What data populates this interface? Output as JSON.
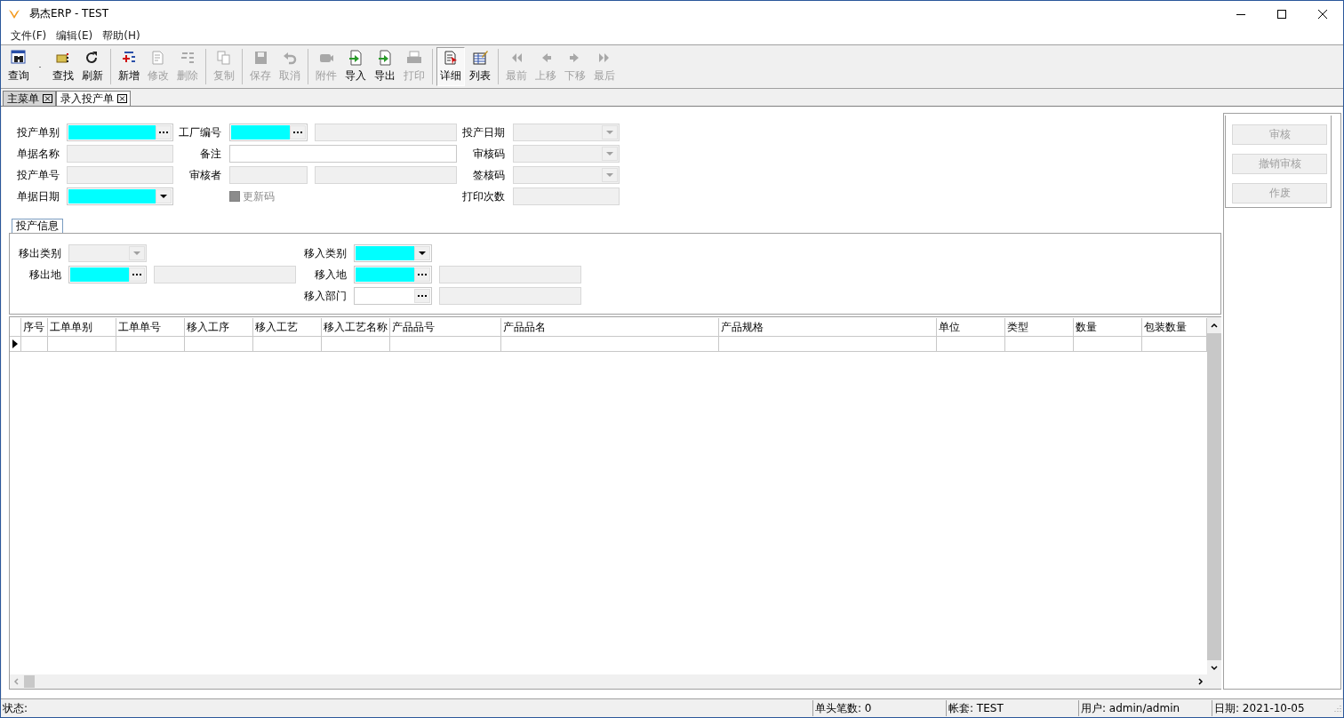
{
  "window": {
    "title": "易杰ERP - TEST"
  },
  "menu": [
    "文件(F)",
    "编辑(E)",
    "帮助(H)"
  ],
  "toolbar": {
    "groups": [
      [
        {
          "label": "查询",
          "disabled": false,
          "has_menu": true
        },
        {
          "label": "查找",
          "disabled": false
        },
        {
          "label": "刷新",
          "disabled": false
        }
      ],
      [
        {
          "label": "新增",
          "disabled": false
        },
        {
          "label": "修改",
          "disabled": true
        },
        {
          "label": "删除",
          "disabled": true
        }
      ],
      [
        {
          "label": "复制",
          "disabled": true
        }
      ],
      [
        {
          "label": "保存",
          "disabled": true
        },
        {
          "label": "取消",
          "disabled": true
        }
      ],
      [
        {
          "label": "附件",
          "disabled": true
        },
        {
          "label": "导入",
          "disabled": false
        },
        {
          "label": "导出",
          "disabled": false
        },
        {
          "label": "打印",
          "disabled": true
        }
      ],
      [
        {
          "label": "详细",
          "disabled": false,
          "selected": true
        },
        {
          "label": "列表",
          "disabled": false,
          "selected": false
        }
      ],
      [
        {
          "label": "最前",
          "disabled": true
        },
        {
          "label": "上移",
          "disabled": true
        },
        {
          "label": "下移",
          "disabled": true
        },
        {
          "label": "最后",
          "disabled": true
        }
      ]
    ]
  },
  "tabs": [
    {
      "label": "主菜单",
      "selected": false
    },
    {
      "label": "录入投产单",
      "selected": true
    }
  ],
  "form_rows": [
    [
      {
        "kind": "lookup",
        "label": "投产单别",
        "required": true,
        "disabled": false
      },
      {
        "kind": "lookup",
        "label": "工厂编号",
        "required": true,
        "disabled": false,
        "extra": true
      },
      {
        "kind": "combo",
        "label": "投产日期",
        "required": false,
        "disabled": true
      }
    ],
    [
      {
        "kind": "text",
        "label": "单据名称",
        "required": false,
        "disabled": true
      },
      {
        "kind": "text",
        "label": "备注",
        "required": false,
        "disabled": false
      },
      {
        "kind": "combo",
        "label": "审核码",
        "required": false,
        "disabled": true
      }
    ],
    [
      {
        "kind": "text",
        "label": "投产单号",
        "required": false,
        "disabled": true
      },
      {
        "kind": "text",
        "label": "审核者",
        "required": false,
        "disabled": true,
        "extra": true
      },
      {
        "kind": "combo",
        "label": "签核码",
        "required": false,
        "disabled": true
      }
    ],
    [
      {
        "kind": "combo",
        "label": "单据日期",
        "required": true,
        "disabled": false
      },
      {
        "kind": "checkbox",
        "label": "更新码",
        "checked": false,
        "disabled": true
      },
      {
        "kind": "text",
        "label": "打印次数",
        "required": false,
        "disabled": true
      }
    ]
  ],
  "group": {
    "title": "投产信息",
    "columns": [
      [
        {
          "kind": "combo",
          "label": "移出类别",
          "required": false,
          "disabled": true
        },
        {
          "kind": "lookup",
          "label": "移出地",
          "required": true,
          "disabled": false,
          "extra": true
        }
      ],
      [
        {
          "kind": "combo",
          "label": "移入类别",
          "required": true,
          "disabled": false
        },
        {
          "kind": "lookup",
          "label": "移入地",
          "required": true,
          "disabled": false,
          "extra": true
        },
        {
          "kind": "lookup",
          "label": "移入部门",
          "required": false,
          "disabled": false,
          "extra": true
        }
      ]
    ]
  },
  "table": {
    "columns": [
      "序号",
      "工单单别",
      "工单单号",
      "移入工序",
      "移入工艺",
      "移入工艺名称",
      "产品品号",
      "产品品名",
      "产品规格",
      "单位",
      "类型",
      "数量",
      "包装数量"
    ],
    "rows": [
      {
        "selected": true
      }
    ]
  },
  "side_buttons": [
    {
      "label": "审核",
      "disabled": true
    },
    {
      "label": "撤销审核",
      "disabled": true
    },
    {
      "label": "作废",
      "disabled": true
    }
  ],
  "status_bar": {
    "label": "状态:",
    "panels": [
      "单头笔数: 0",
      "帐套: TEST",
      "用户: admin/admin",
      "日期: 2021-10-05"
    ]
  }
}
